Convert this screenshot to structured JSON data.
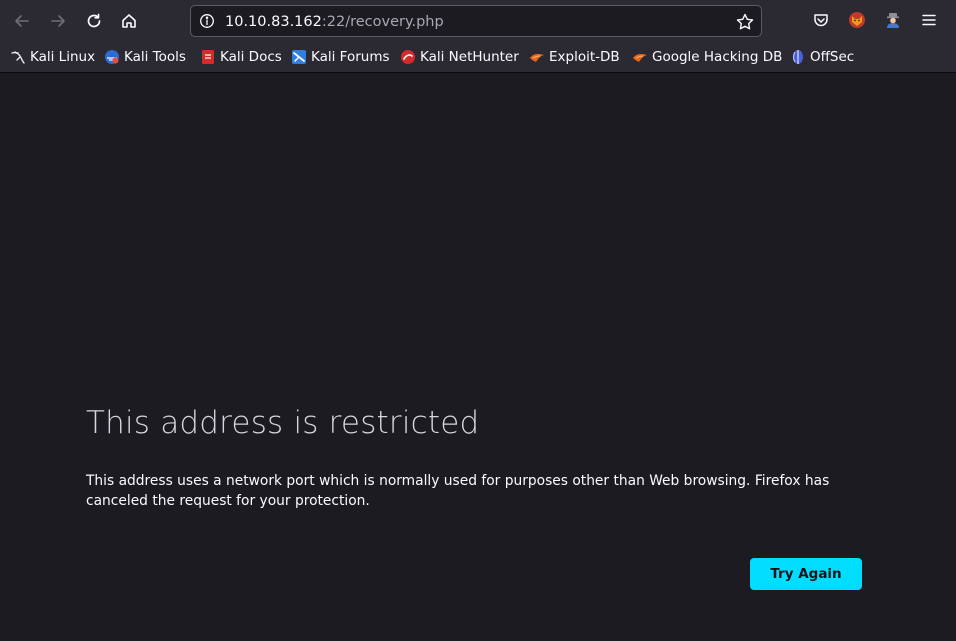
{
  "toolbar": {
    "url_host": "10.10.83.162",
    "url_rest": ":22/recovery.php",
    "back_icon": "back-arrow-icon",
    "forward_icon": "forward-arrow-icon",
    "reload_icon": "reload-icon",
    "home_icon": "home-icon"
  },
  "bookmarks": [
    {
      "label": "Kali Linux",
      "icon": "kali-dragon-icon"
    },
    {
      "label": "Kali Tools",
      "icon": "kali-tools-icon"
    },
    {
      "label": "Kali Docs",
      "icon": "kali-docs-icon"
    },
    {
      "label": "Kali Forums",
      "icon": "kali-forums-icon"
    },
    {
      "label": "Kali NetHunter",
      "icon": "kali-nethunter-icon"
    },
    {
      "label": "Exploit-DB",
      "icon": "exploit-db-icon"
    },
    {
      "label": "Google Hacking DB",
      "icon": "ghdb-icon"
    },
    {
      "label": "OffSec",
      "icon": "offsec-icon"
    }
  ],
  "error": {
    "title": "This address is restricted",
    "description": "This address uses a network port which is normally used for purposes other than Web browsing. Firefox has canceled the request for your protection.",
    "button_label": "Try Again"
  },
  "colors": {
    "page_bg": "#1c1b22",
    "toolbar_bg": "#2b2a33",
    "accent_button": "#00ddff"
  }
}
